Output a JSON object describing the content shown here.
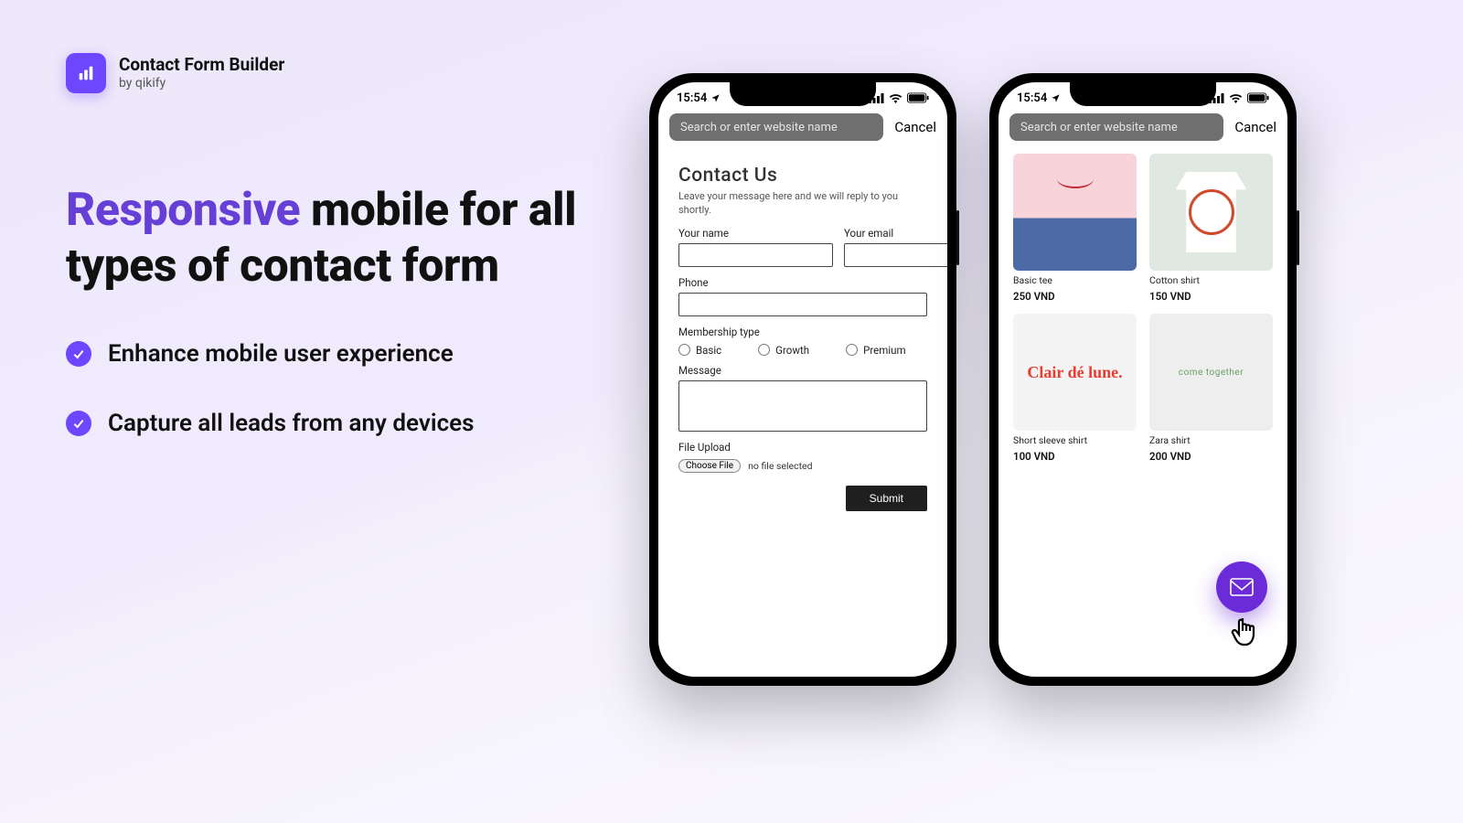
{
  "brand": {
    "title": "Contact Form Builder",
    "subtitle": "by qikify"
  },
  "headline": {
    "accent": "Responsive",
    "rest": " mobile for all types of contact form"
  },
  "bullets": [
    "Enhance mobile user experience",
    "Capture all leads from any devices"
  ],
  "phone_shared": {
    "clock": "15:54",
    "url_placeholder": "Search or enter website name",
    "cancel": "Cancel"
  },
  "contact_form": {
    "title": "Contact Us",
    "subtitle": "Leave your message here and we will reply to you shortly.",
    "name_label": "Your name",
    "email_label": "Your email",
    "phone_label": "Phone",
    "membership_label": "Membership type",
    "radios": {
      "basic": "Basic",
      "growth": "Growth",
      "premium": "Premium"
    },
    "message_label": "Message",
    "file_label": "File Upload",
    "file_button": "Choose File",
    "file_status": "no file selected",
    "submit": "Submit"
  },
  "products": [
    {
      "name": "Basic tee",
      "price": "250 VND",
      "art": "p1"
    },
    {
      "name": "Cotton shirt",
      "price": "150 VND",
      "art": "p2"
    },
    {
      "name": "Short sleeve shirt",
      "price": "100 VND",
      "art": "p3",
      "art_text": "Clair dé lune."
    },
    {
      "name": "Zara shirt",
      "price": "200 VND",
      "art": "p4",
      "art_text": "come together"
    }
  ]
}
